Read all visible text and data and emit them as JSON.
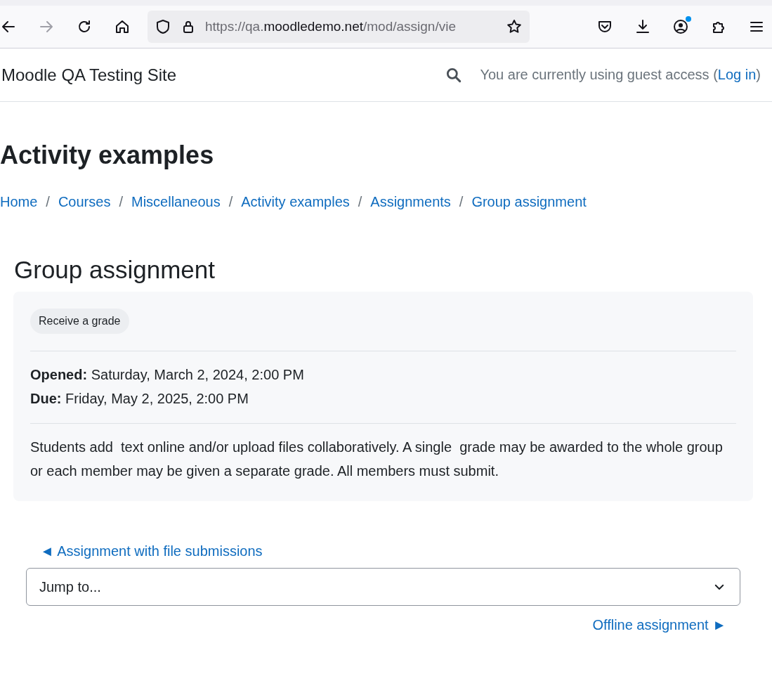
{
  "browser": {
    "nav_buttons": [
      {
        "kind": "back",
        "disabled": false
      },
      {
        "kind": "forward",
        "disabled": true
      },
      {
        "kind": "reload",
        "disabled": false
      },
      {
        "kind": "home",
        "disabled": false
      }
    ],
    "url": {
      "prefix": "https://qa.",
      "domain": "moodledemo.net",
      "path": "/mod/assign/vie"
    },
    "toolbar": [
      {
        "kind": "pocket"
      },
      {
        "kind": "download"
      },
      {
        "kind": "account",
        "notification": true
      },
      {
        "kind": "extensions"
      },
      {
        "kind": "menu"
      }
    ]
  },
  "header": {
    "site_name": "Moodle QA Testing Site",
    "guest_prefix": "You are currently using guest access (",
    "login_link": "Log in",
    "guest_suffix": ")"
  },
  "page_title": "Activity examples",
  "breadcrumb": {
    "separator": "/",
    "items": [
      "Home",
      "Courses",
      "Miscellaneous",
      "Activity examples",
      "Assignments",
      "Group assignment"
    ]
  },
  "activity": {
    "title": "Group assignment",
    "completion_badge": "Receive a grade",
    "dates": [
      "**Opened:** Saturday, March 2, 2024, 2:00 PM",
      "**Due:** Friday, May 2, 2025, 2:00 PM"
    ],
    "description": "Students add  text online and/or upload files collaboratively. A single  grade may be awarded to the whole group or each member may be given a separate grade. All members must submit."
  },
  "navigation": {
    "previous": "◄ Assignment with file submissions",
    "jump_to": "Jump to...",
    "next": "Offline assignment ►"
  }
}
